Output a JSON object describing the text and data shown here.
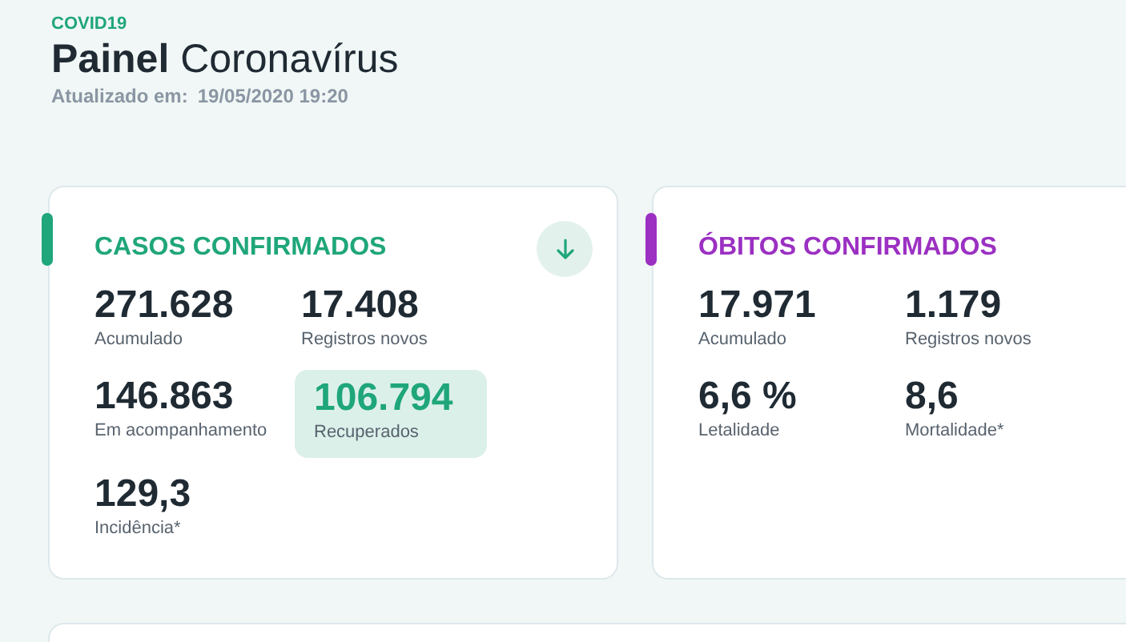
{
  "header": {
    "eyebrow": "COVID19",
    "title": "**Painel** Coronavírus",
    "updated_label": "Atualizado em:",
    "updated_value": "19/05/2020 19:20"
  },
  "cards": [
    {
      "title": "CASOS CONFIRMADOS",
      "color": "#1fa67a",
      "download_button": true,
      "stats": [
        {
          "value": "271.628",
          "label": "Acumulado",
          "highlighted": false
        },
        {
          "value": "17.408",
          "label": "Registros novos",
          "highlighted": false
        },
        {
          "value": "146.863",
          "label": "Em acompanhamento",
          "highlighted": false
        },
        {
          "value": "106.794",
          "label": "Recuperados",
          "highlighted": true
        },
        {
          "value": "129,3",
          "label": "Incidência*",
          "highlighted": false
        }
      ]
    },
    {
      "title": "ÓBITOS CONFIRMADOS",
      "color": "#9b30c2",
      "download_button": false,
      "stats": [
        {
          "value": "17.971",
          "label": "Acumulado",
          "highlighted": false
        },
        {
          "value": "1.179",
          "label": "Registros novos",
          "highlighted": false
        },
        {
          "value": "6,6 %",
          "label": "Letalidade",
          "highlighted": false
        },
        {
          "value": "8,6",
          "label": "Mortalidade*",
          "highlighted": false
        }
      ]
    }
  ]
}
